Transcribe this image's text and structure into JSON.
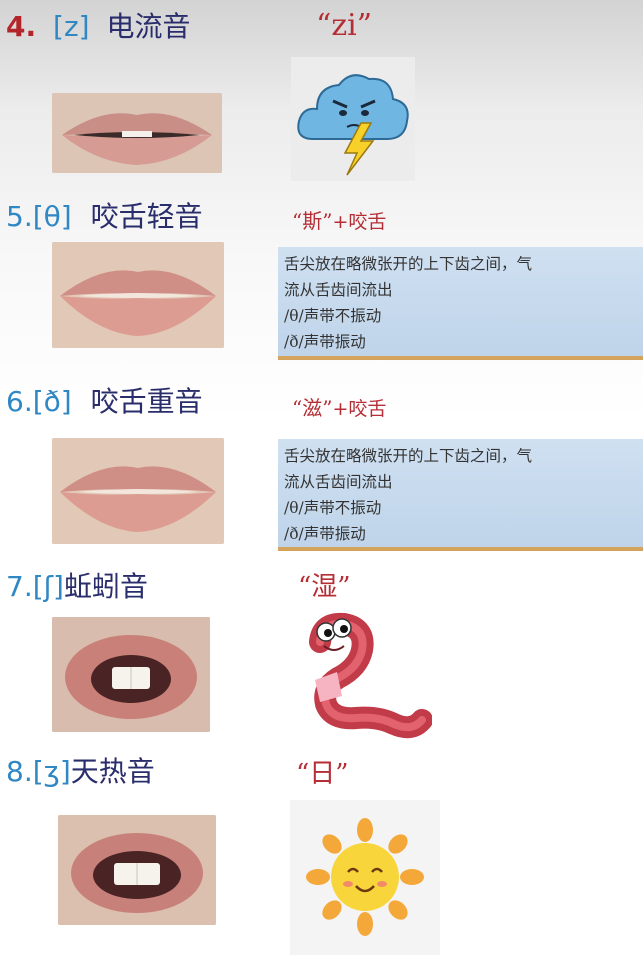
{
  "items": [
    {
      "num": "4.",
      "ipa": "[z]",
      "name": "电流音",
      "quote": "“zi”",
      "picture": "cloud-lightning"
    },
    {
      "num": "5.",
      "ipa": "[θ]",
      "name": "咬舌轻音",
      "quote": "“斯”",
      "plus": "+咬舌",
      "note": [
        "舌尖放在略微张开的上下齿之间，气",
        "流从舌齿间流出",
        "/θ/声带不振动",
        "/ð/声带振动"
      ]
    },
    {
      "num": "6.",
      "ipa": "[ð]",
      "name": "咬舌重音",
      "quote": "“滋”",
      "plus": "+咬舌",
      "note": [
        "舌尖放在略微张开的上下齿之间，气",
        "流从舌齿间流出",
        "/θ/声带不振动",
        "/ð/声带振动"
      ]
    },
    {
      "num": "7.",
      "ipa": "[ʃ]",
      "name": "蚯蚓音",
      "quote": "“湿”",
      "picture": "worm"
    },
    {
      "num": "8.",
      "ipa": "[ʒ]",
      "name": "天热音",
      "quote": "“日”",
      "picture": "sun"
    }
  ],
  "colors": {
    "red": "#b3252b",
    "blue": "#2f87c4",
    "navy": "#2a2d6b",
    "quote_red": "#b62e35",
    "note_bg": "#c8dbee",
    "note_border": "#d4a45c"
  }
}
